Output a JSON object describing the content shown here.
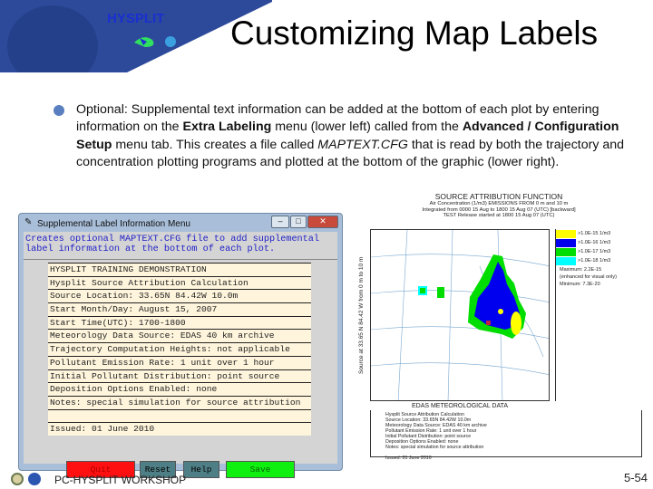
{
  "slide": {
    "title": "Customizing Map Labels",
    "logo_text": "HYSPLIT",
    "paragraph": {
      "p1": "Optional: Supplemental text information can be added at the bottom of each plot by entering information on the ",
      "b1": "Extra Labeling",
      "p2": " menu (lower left) called from the ",
      "b2": "Advanced / Configuration Setup",
      "p3": " menu tab. This creates a file called ",
      "i1": "MAPTEXT.CFG",
      "p4": " that is read by both the trajectory and concentration plotting programs and plotted at the bottom of the graphic (lower right)."
    },
    "footer": "PC-HYSPLIT WORKSHOP",
    "page_number": "5-54"
  },
  "dialog": {
    "title": "Supplemental Label Information Menu",
    "description": "Creates optional MAPTEXT.CFG file to add supplemental label information at the bottom of each plot.",
    "fields": [
      "HYSPLIT TRAINING DEMONSTRATION",
      "Hysplit Source Attribution Calculation",
      "Source Location: 33.65N 84.42W 10.0m",
      "Start Month/Day: August 15, 2007",
      "Start Time(UTC): 1700-1800",
      "Meteorology Data Source: EDAS 40 km archive",
      "Trajectory Computation Heights: not applicable",
      "Pollutant Emission Rate: 1 unit over 1 hour",
      "Initial Pollutant Distribution: point source",
      "Deposition Options Enabled: none",
      "Notes: special simulation for source attribution",
      "",
      "Issued: 01 June 2010"
    ],
    "buttons": {
      "quit": "Quit",
      "reset": "Reset",
      "help": "Help",
      "save": "Save"
    },
    "colors": {
      "quit": "#ff1010",
      "reset": "#4f7f86",
      "help": "#4f7f86",
      "save": "#10f010"
    }
  },
  "map": {
    "title": "SOURCE ATTRIBUTION FUNCTION",
    "subtitles": [
      "Air Concentration (1/m3) EMISSIONS FROM 0 m and 10 m",
      "Integrated from 0000 15 Aug to 1800 15 Aug 07 (UTC) [backward]",
      "TEST Release started at 1800 15 Aug 07 (UTC)"
    ],
    "ylabel": "Source at 33.65 N 84.42 W from 0 m to 10 m",
    "xlabel": "EDAS METEOROLOGICAL DATA",
    "legend": [
      {
        "label": ">1.0E-15 1/m3",
        "color": "#ffff00"
      },
      {
        "label": ">1.0E-16 1/m3",
        "color": "#0000ee"
      },
      {
        "label": ">1.0E-17 1/m3",
        "color": "#00dd00"
      },
      {
        "label": ">1.0E-18 1/m3",
        "color": "#00ffff"
      }
    ],
    "maximum": "Maximum: 2.2E-15",
    "maximum_note": "(enhanced for visual only)",
    "minimum": "Minimum: 7.3E-20",
    "bottom_lines": [
      "Hysplit Source Attribution Calculation",
      "Source Location: 33.65N 84.42W 10.0m",
      "Meteorology Data Source: EDAS 40 km archive",
      "Pollutant Emission Rate: 1 unit over 1 hour",
      "Initial Pollutant Distribution: point source",
      "Deposition Options Enabled: none",
      "Notes: special simulation for source attribution",
      "",
      "Issued: 01 June 2010"
    ]
  }
}
